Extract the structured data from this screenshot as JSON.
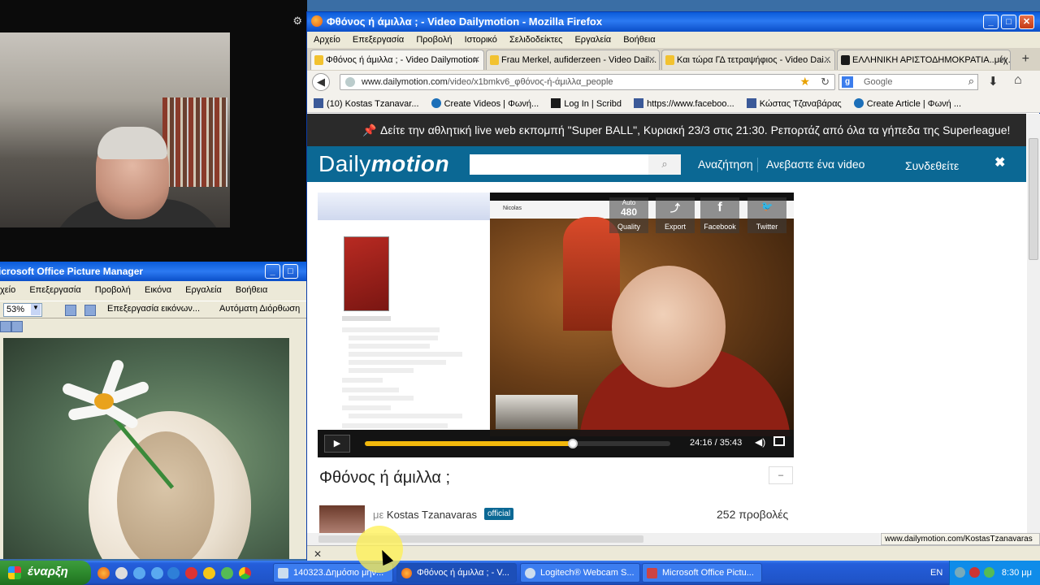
{
  "picture_manager": {
    "title": "icrosoft Office Picture Manager",
    "menu": [
      "χείο",
      "Επεξεργασία",
      "Προβολή",
      "Εικόνα",
      "Εργαλεία",
      "Βοήθεια"
    ],
    "zoom": "53%",
    "edit_pictures": "Επεξεργασία εικόνων...",
    "auto_correct": "Αυτόματη Διόρθωση"
  },
  "firefox": {
    "title": "Φθόνος ή άμιλλα ; - Video Dailymotion - Mozilla Firefox",
    "menu": [
      "Αρχείο",
      "Επεξεργασία",
      "Προβολή",
      "Ιστορικό",
      "Σελιδοδείκτες",
      "Εργαλεία",
      "Βοήθεια"
    ],
    "tabs": [
      {
        "label": "Φθόνος ή άμιλλα ; - Video Dailymotion"
      },
      {
        "label": "Frau Merkel, aufiderzeen - Video Dail..."
      },
      {
        "label": "Και τώρα ΓΔ τετραψήφιος - Video Dai..."
      },
      {
        "label": "ΕΛΛΗΝΙΚΗ ΑΡΙΣΤΟΔΗΜΟΚΡΑΤΙΑ..μέχ..."
      }
    ],
    "url_host": "www.dailymotion.com",
    "url_path": "/video/x1bmkv6_φθόνος-ή-άμιλλα_people",
    "search_placeholder": "Google",
    "bookmarks": [
      "(10) Kostas Tzanavar...",
      "Create Videos | Φωνή...",
      "Log In | Scribd",
      "https://www.faceboo...",
      "Κώστας Τζαναβάρας",
      "Create Article | Φωνή ..."
    ],
    "status_url": "www.dailymotion.com/KostasTzanavaras"
  },
  "dailymotion": {
    "promo": "Δείτε την αθλητική live web εκπομπή \"Super BALL\", Κυριακή 23/3 στις 21:30. Ρεπορτάζ από όλα τα γήπεδα της Superleague!",
    "logo_a": "Daily",
    "logo_b": "motion",
    "nav_search": "Αναζήτηση",
    "nav_upload": "Ανεβαστε ένα video",
    "login": "Συνδεθείτε",
    "player": {
      "quality_top": "Auto",
      "quality_value": "480",
      "quality_label": "Quality",
      "export_label": "Export",
      "facebook_label": "Facebook",
      "twitter_label": "Twitter",
      "time": "24:16 / 35:43",
      "progress": 0.68,
      "cam_name": "Nicolas"
    },
    "video_title": "Φθόνος ή άμιλλα ;",
    "by": "με ",
    "channel": "Kostas Tzanavaras",
    "official": "official",
    "views": "252 προβολές"
  },
  "taskbar": {
    "start": "έναρξη",
    "tasks": [
      {
        "label": "140323.Δημόσιο μην..."
      },
      {
        "label": "Φθόνος ή άμιλλα ; - V..."
      },
      {
        "label": "Logitech® Webcam S..."
      },
      {
        "label": "Microsoft Office Pictu..."
      }
    ],
    "lang": "EN",
    "clock": "8:30 μμ"
  }
}
